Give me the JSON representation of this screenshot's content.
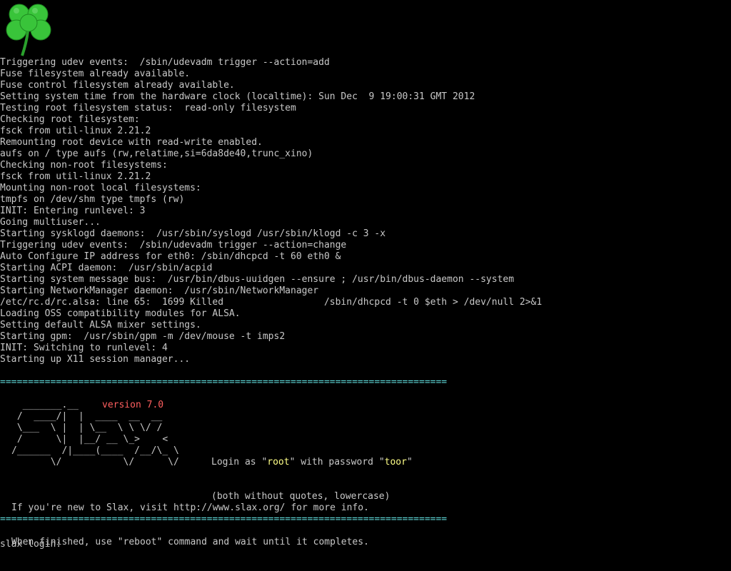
{
  "logo": {
    "icon": "clover-icon",
    "color": "#39c43a"
  },
  "boot_lines": [
    "Triggering udev events:  /sbin/udevadm trigger --action=add",
    "Fuse filesystem already available.",
    "Fuse control filesystem already available.",
    "Setting system time from the hardware clock (localtime): Sun Dec  9 19:00:31 GMT 2012",
    "Testing root filesystem status:  read-only filesystem",
    "Checking root filesystem:",
    "fsck from util-linux 2.21.2",
    "Remounting root device with read-write enabled.",
    "aufs on / type aufs (rw,relatime,si=6da8de40,trunc_xino)",
    "Checking non-root filesystems:",
    "fsck from util-linux 2.21.2",
    "Mounting non-root local filesystems:",
    "tmpfs on /dev/shm type tmpfs (rw)",
    "INIT: Entering runlevel: 3",
    "Going multiuser...",
    "Starting sysklogd daemons:  /usr/sbin/syslogd /usr/sbin/klogd -c 3 -x",
    "Triggering udev events:  /sbin/udevadm trigger --action=change",
    "Auto Configure IP address for eth0: /sbin/dhcpcd -t 60 eth0 &",
    "Starting ACPI daemon:  /usr/sbin/acpid",
    "Starting system message bus:  /usr/bin/dbus-uuidgen --ensure ; /usr/bin/dbus-daemon --system",
    "Starting NetworkManager daemon:  /usr/sbin/NetworkManager",
    "/etc/rc.d/rc.alsa: line 65:  1699 Killed                  /sbin/dhcpcd -t 0 $eth > /dev/null 2>&1",
    "Loading OSS compatibility modules for ALSA.",
    "Setting default ALSA mixer settings.",
    "Starting gpm:  /usr/sbin/gpm -m /dev/mouse -t imps2",
    "INIT: Switching to runlevel: 4",
    "Starting up X11 session manager..."
  ],
  "separator": "================================================================================",
  "version_label": "version 7.0",
  "ascii_art": "  _______.__\n /  ____/|  |  ____  __  __\n \\___  \\ |  | \\__  \\ \\ \\/ /\n /      \\|  |__/ __ \\_>    <\n/______  /|____(____  /__/\\_ \\\n       \\/           \\/      \\/",
  "banner": {
    "login_prefix": "Login as \"",
    "login_user": "root",
    "login_mid": "\" with password \"",
    "login_password": "toor",
    "login_suffix": "\"",
    "note": "(both without quotes, lowercase)"
  },
  "info": {
    "line1": "If you're new to Slax, visit http://www.slax.org/ for more info.",
    "line2": "When finished, use \"reboot\" command and wait until it completes."
  },
  "prompt": "slax login: "
}
